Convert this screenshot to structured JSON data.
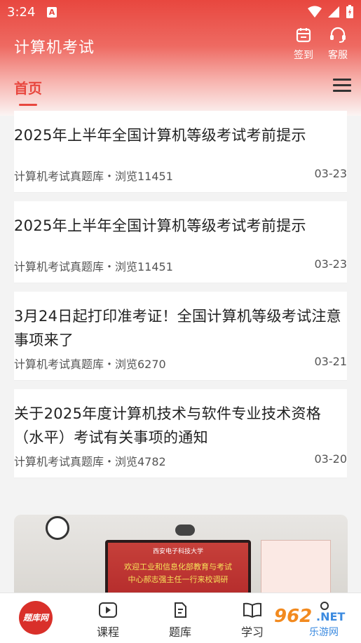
{
  "status": {
    "time": "3:24",
    "a_badge": "A"
  },
  "header": {
    "title": "计算机考试",
    "actions": [
      {
        "label": "签到",
        "icon": "calendar-icon"
      },
      {
        "label": "客服",
        "icon": "headset-icon"
      }
    ],
    "tab_home": "首页",
    "colors": {
      "accent": "#e8473f"
    }
  },
  "articles": [
    {
      "title": "2025年上半年全国计算机等级考试考前提示",
      "source": "计算机考试真题库・浏览11451",
      "date": "03-23"
    },
    {
      "title": "2025年上半年全国计算机等级考试考前提示",
      "source": "计算机考试真题库・浏览11451",
      "date": "03-23"
    },
    {
      "title": "3月24日起打印准考证！全国计算机等级考试注意事项来了",
      "source": "计算机考试真题库・浏览6270",
      "date": "03-21"
    },
    {
      "title": "关于2025年度计算机技术与软件专业技术资格（水平）考试有关事项的通知",
      "source": "计算机考试真题库・浏览4782",
      "date": "03-20"
    }
  ],
  "image_card": {
    "screen_head": "西安电子科技大学",
    "screen_lines": [
      "欢迎工业和信息化部教育与考试",
      "中心郝志强主任一行来校调研"
    ]
  },
  "bottom_nav": {
    "logo_text": "题库网",
    "items": [
      {
        "label": "课程",
        "icon": "play-icon"
      },
      {
        "label": "题库",
        "icon": "document-icon"
      },
      {
        "label": "学习",
        "icon": "book-icon"
      },
      {
        "label": "",
        "icon": "person-icon"
      }
    ]
  },
  "watermark": {
    "num": "962",
    "net": ".NET",
    "sub": "乐游网"
  }
}
